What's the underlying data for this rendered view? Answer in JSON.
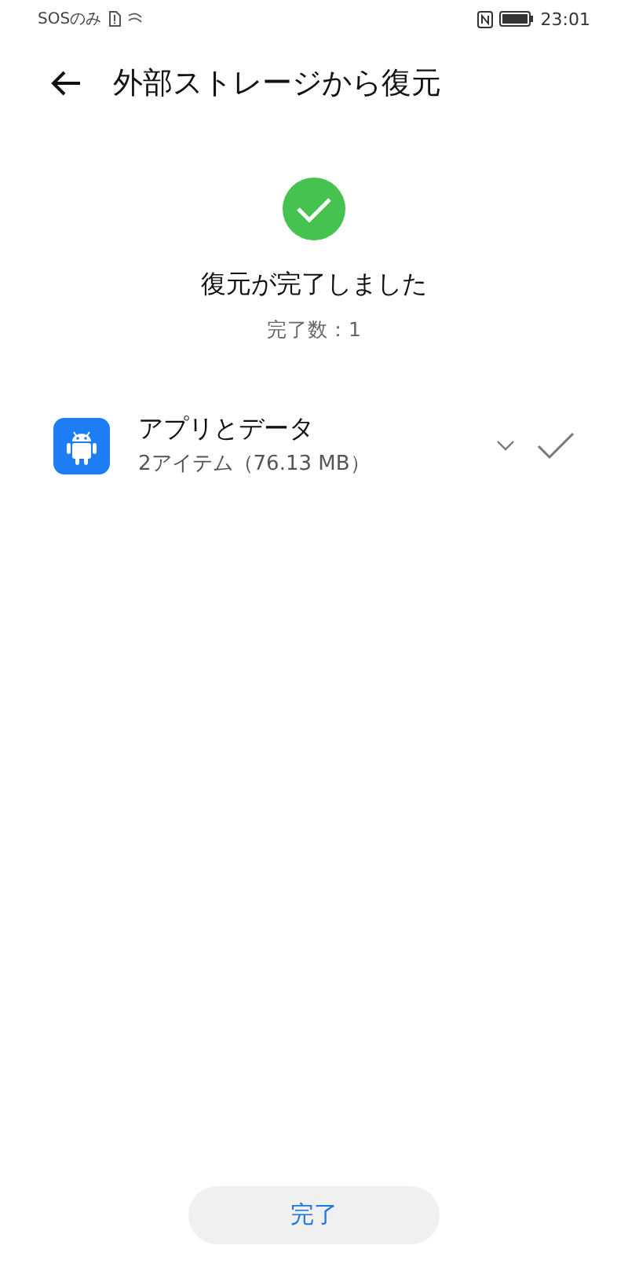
{
  "status_bar": {
    "carrier": "SOSのみ",
    "time": "23:01"
  },
  "header": {
    "title": "外部ストレージから復元"
  },
  "result": {
    "title": "復元が完了しました",
    "count": "完了数：1"
  },
  "items": [
    {
      "name": "アプリとデータ",
      "detail": "2アイテム（76.13 MB）",
      "expanded": false,
      "restored": true
    }
  ],
  "done_button": "完了"
}
